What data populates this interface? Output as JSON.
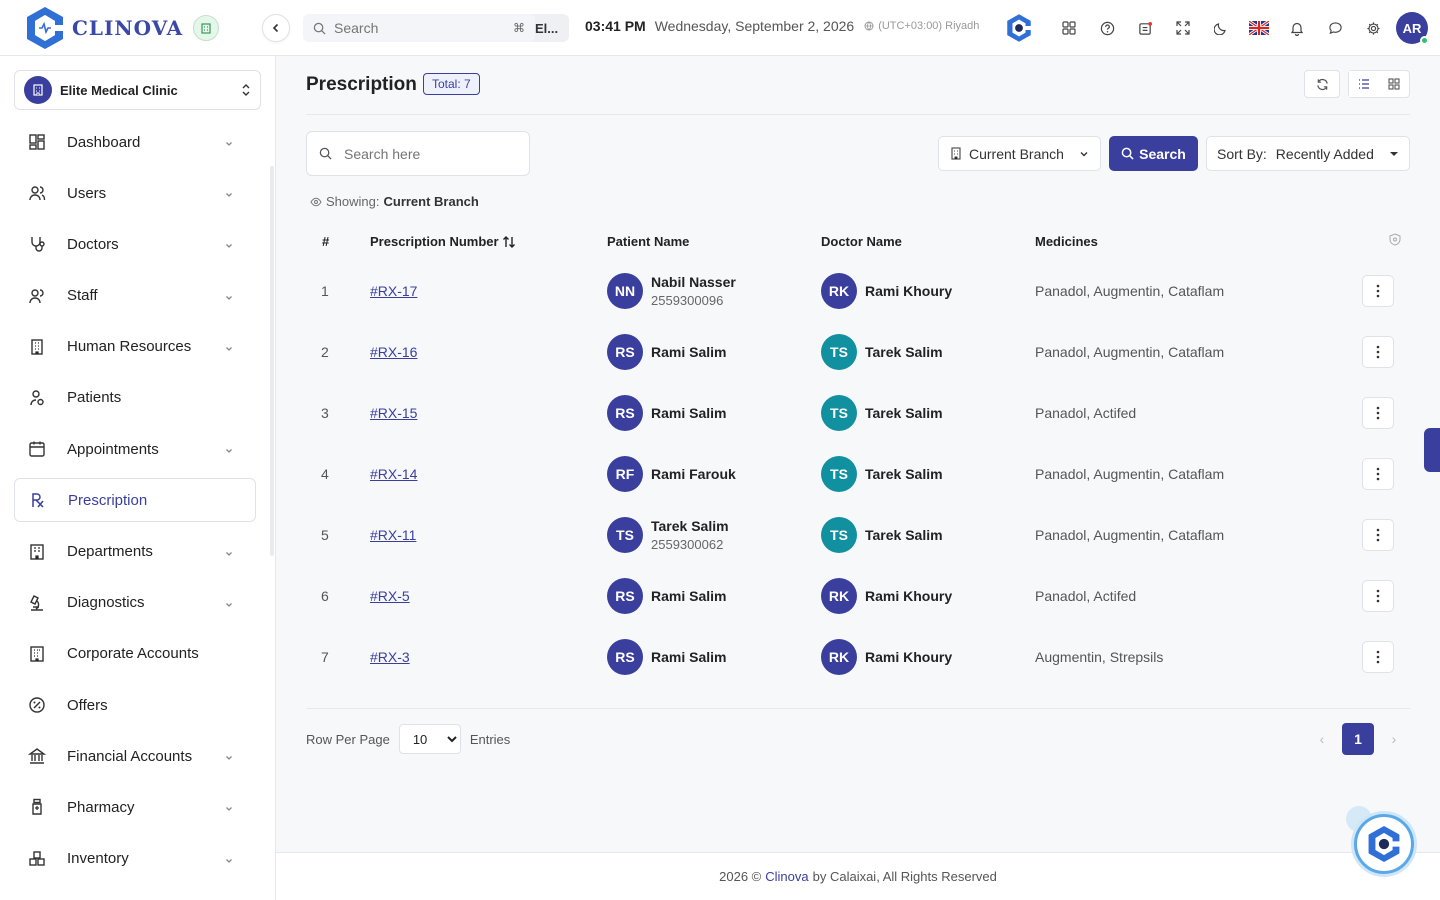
{
  "app": {
    "name": "CLINOVA"
  },
  "topbar": {
    "search_placeholder": "Search",
    "search_shortcut": "⌘",
    "search_trailing": "El...",
    "time": "03:41 PM",
    "date": "Wednesday, September 2, 2026",
    "timezone": "(UTC+03:00) Riyadh",
    "user_initials": "AR"
  },
  "sidebar": {
    "branch": "Elite Medical Clinic",
    "items": [
      {
        "label": "Dashboard",
        "icon": "dashboard-icon",
        "chevron": true
      },
      {
        "label": "Users",
        "icon": "users-icon",
        "chevron": true
      },
      {
        "label": "Doctors",
        "icon": "stethoscope-icon",
        "chevron": true
      },
      {
        "label": "Staff",
        "icon": "staff-icon",
        "chevron": true
      },
      {
        "label": "Human Resources",
        "icon": "building-icon",
        "chevron": true
      },
      {
        "label": "Patients",
        "icon": "patient-icon",
        "chevron": false
      },
      {
        "label": "Appointments",
        "icon": "calendar-icon",
        "chevron": true
      },
      {
        "label": "Prescription",
        "icon": "rx-icon",
        "chevron": false,
        "active": true
      },
      {
        "label": "Departments",
        "icon": "department-icon",
        "chevron": true
      },
      {
        "label": "Diagnostics",
        "icon": "microscope-icon",
        "chevron": true
      },
      {
        "label": "Corporate Accounts",
        "icon": "office-icon",
        "chevron": false
      },
      {
        "label": "Offers",
        "icon": "discount-icon",
        "chevron": false
      },
      {
        "label": "Financial Accounts",
        "icon": "bank-icon",
        "chevron": true
      },
      {
        "label": "Pharmacy",
        "icon": "bottle-icon",
        "chevron": true
      },
      {
        "label": "Inventory",
        "icon": "boxes-icon",
        "chevron": true
      }
    ]
  },
  "page": {
    "title": "Prescription",
    "total_badge": "Total: 7",
    "search_placeholder": "Search here",
    "branch_filter": "Current Branch",
    "search_button": "Search",
    "sort_label": "Sort By:",
    "sort_value": "Recently Added",
    "showing_label": "Showing:",
    "showing_value": "Current Branch"
  },
  "table": {
    "headers": {
      "index": "#",
      "number": "Prescription Number",
      "patient": "Patient Name",
      "doctor": "Doctor Name",
      "medicines": "Medicines"
    },
    "rows": [
      {
        "idx": "1",
        "rx": "#RX-17",
        "patient": {
          "initials": "NN",
          "name": "Nabil Nasser",
          "phone": "2559300096"
        },
        "doctor": {
          "initials": "RK",
          "name": "Rami Khoury"
        },
        "medicines": "Panadol, Augmentin, Cataflam"
      },
      {
        "idx": "2",
        "rx": "#RX-16",
        "patient": {
          "initials": "RS",
          "name": "Rami Salim",
          "phone": ""
        },
        "doctor": {
          "initials": "TS",
          "name": "Tarek Salim"
        },
        "medicines": "Panadol, Augmentin, Cataflam"
      },
      {
        "idx": "3",
        "rx": "#RX-15",
        "patient": {
          "initials": "RS",
          "name": "Rami Salim",
          "phone": ""
        },
        "doctor": {
          "initials": "TS",
          "name": "Tarek Salim"
        },
        "medicines": "Panadol, Actifed"
      },
      {
        "idx": "4",
        "rx": "#RX-14",
        "patient": {
          "initials": "RF",
          "name": "Rami Farouk",
          "phone": ""
        },
        "doctor": {
          "initials": "TS",
          "name": "Tarek Salim"
        },
        "medicines": "Panadol, Augmentin, Cataflam"
      },
      {
        "idx": "5",
        "rx": "#RX-11",
        "patient": {
          "initials": "TS",
          "name": "Tarek Salim",
          "phone": "2559300062"
        },
        "doctor": {
          "initials": "TS",
          "name": "Tarek Salim"
        },
        "medicines": "Panadol, Augmentin, Cataflam"
      },
      {
        "idx": "6",
        "rx": "#RX-5",
        "patient": {
          "initials": "RS",
          "name": "Rami Salim",
          "phone": ""
        },
        "doctor": {
          "initials": "RK",
          "name": "Rami Khoury"
        },
        "medicines": "Panadol, Actifed"
      },
      {
        "idx": "7",
        "rx": "#RX-3",
        "patient": {
          "initials": "RS",
          "name": "Rami Salim",
          "phone": ""
        },
        "doctor": {
          "initials": "RK",
          "name": "Rami Khoury"
        },
        "medicines": "Augmentin, Strepsils"
      }
    ]
  },
  "pagination": {
    "rows_label": "Row Per Page",
    "rows_value": "10",
    "entries_label": "Entries",
    "current_page": "1",
    "prev": "‹",
    "next": "›"
  },
  "footer": {
    "year": "2026 ©",
    "brand": "Clinova",
    "suffix": "by Calaixai, All Rights Reserved"
  },
  "colors": {
    "primary": "#3a3f9e",
    "teal": "#11909f"
  }
}
